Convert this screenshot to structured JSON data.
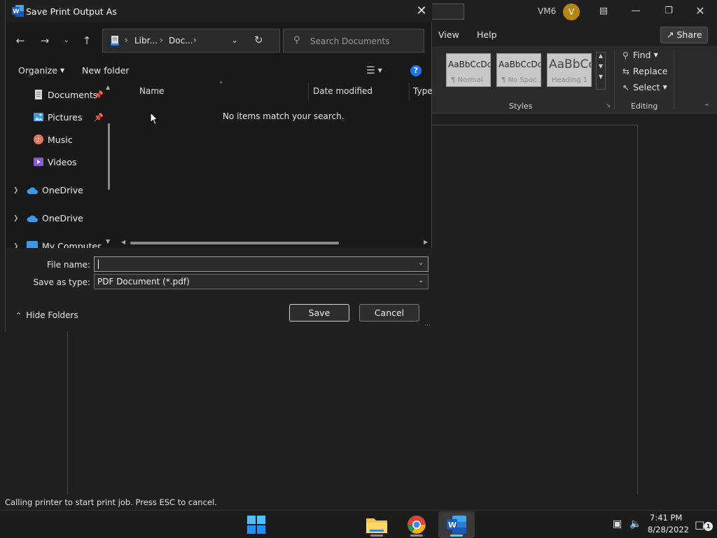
{
  "word": {
    "account_name": "VM6",
    "avatar_letter": "V",
    "ribbon_tabs": {
      "view": "View",
      "help": "Help"
    },
    "share_label": "Share",
    "styles": [
      {
        "sample": "AaBbCcDc",
        "name": "¶ Normal"
      },
      {
        "sample": "AaBbCcDc",
        "name": "¶ No Spac..."
      },
      {
        "sample": "AaBbCc",
        "name": "Heading 1"
      }
    ],
    "styles_group_label": "Styles",
    "editing": {
      "find": "Find",
      "replace": "Replace",
      "select": "Select",
      "group_label": "Editing"
    },
    "status_text": "Calling printer to start print job. Press ESC to cancel."
  },
  "taskbar": {
    "time": "7:41 PM",
    "date": "8/28/2022",
    "notification_count": "1"
  },
  "dialog": {
    "title": "Save Print Output As",
    "address": {
      "segment1": "Libr...",
      "segment2": "Doc...",
      "separator": "›"
    },
    "search_placeholder": "Search Documents",
    "toolbar": {
      "organize": "Organize",
      "new_folder": "New folder"
    },
    "nav_items": {
      "documents": "Documents",
      "pictures": "Pictures",
      "music": "Music",
      "videos": "Videos",
      "onedrive1": "OneDrive",
      "onedrive2": "OneDrive",
      "my_computer": "My Computer"
    },
    "columns": {
      "name": "Name",
      "date_modified": "Date modified",
      "type": "Type"
    },
    "empty_message": "No items match your search.",
    "file_name_label": "File name:",
    "file_name_value": "",
    "save_type_label": "Save as type:",
    "save_type_value": "PDF Document (*.pdf)",
    "hide_folders": "Hide Folders",
    "save_button": "Save",
    "cancel_button": "Cancel"
  }
}
